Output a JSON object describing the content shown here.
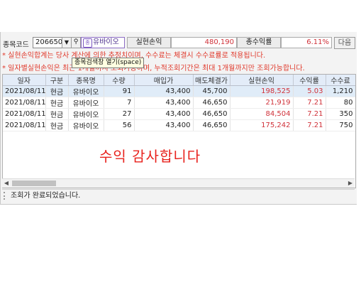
{
  "toolbar": {
    "code_label": "종목코드",
    "code_value": "206650",
    "dropdown_icon": "chevron-down-icon",
    "search_icon": "search-icon",
    "stock_name": "유바이오",
    "tooltip": "종목검색창 열기(space)",
    "profit_label": "실현손익",
    "profit_value": "480,190",
    "total_rate_label": "총수익률",
    "total_rate_value": "6.11%",
    "next_label": "다음"
  },
  "notes": {
    "line1": "* 실현손익합계는 당사 계산에 의한 추정치이며, 수수료는 체결시 수수료률로 적용됩니다.",
    "line2": "* 일자별실현손익은 최근 1개월까지 조회가능하며, 누적조회기간은 최대 1개월까지만 조회가능합니다."
  },
  "table": {
    "columns": [
      "일자",
      "구분",
      "종목명",
      "수량",
      "매입가",
      "매도체결가",
      "실현손익",
      "수익률",
      "수수료"
    ],
    "rows": [
      [
        "2021/08/11",
        "현금",
        "유바이오",
        "91",
        "43,400",
        "45,700",
        "198,525",
        "5.03",
        "1,210"
      ],
      [
        "2021/08/11",
        "현금",
        "유바이오",
        "7",
        "43,400",
        "46,650",
        "21,919",
        "7.21",
        "80"
      ],
      [
        "2021/08/11",
        "현금",
        "유바이오",
        "27",
        "43,400",
        "46,650",
        "84,504",
        "7.21",
        "350"
      ],
      [
        "2021/08/11",
        "현금",
        "유바이오",
        "56",
        "43,400",
        "46,650",
        "175,242",
        "7.21",
        "750"
      ]
    ]
  },
  "overlay_text": "수익 감사합니다",
  "status_text": "조회가 완료되었습니다.",
  "colors": {
    "profit": "#d0323a",
    "header_bg": "#e3ecf8",
    "selected_row": "#e0ecf8"
  }
}
